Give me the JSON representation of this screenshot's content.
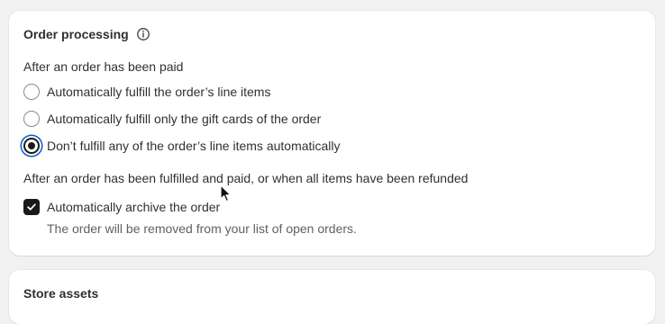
{
  "order_processing": {
    "title": "Order processing",
    "paid_section_label": "After an order has been paid",
    "fulfillment_options": [
      {
        "label": "Automatically fulfill the order’s line items",
        "checked": false
      },
      {
        "label": "Automatically fulfill only the gift cards of the order",
        "checked": false
      },
      {
        "label": "Don’t fulfill any of the order’s line items automatically",
        "checked": true
      }
    ],
    "archive_section_label": "After an order has been fulfilled and paid, or when all items have been refunded",
    "archive_option": {
      "label": "Automatically archive the order",
      "checked": true,
      "help_text": "The order will be removed from your list of open orders."
    }
  },
  "store_assets": {
    "title": "Store assets"
  },
  "colors": {
    "page_background": "#f1f1f1",
    "card_background": "#ffffff",
    "focus_ring": "#005bd3",
    "control_dark": "#1a1a1a"
  },
  "icons": {
    "info": "info-icon",
    "check": "checkmark-icon",
    "cursor": "mouse-pointer-icon"
  }
}
